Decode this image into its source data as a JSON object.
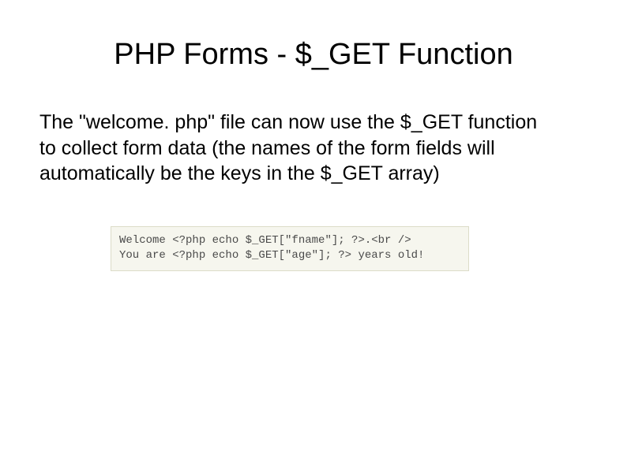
{
  "slide": {
    "title": "PHP Forms - $_GET Function",
    "body": "The \"welcome. php\" file can now use the $_GET function to collect form data (the names of the form fields will automatically be the keys in the $_GET array)",
    "code": "Welcome <?php echo $_GET[\"fname\"]; ?>.<br />\nYou are <?php echo $_GET[\"age\"]; ?> years old!"
  }
}
